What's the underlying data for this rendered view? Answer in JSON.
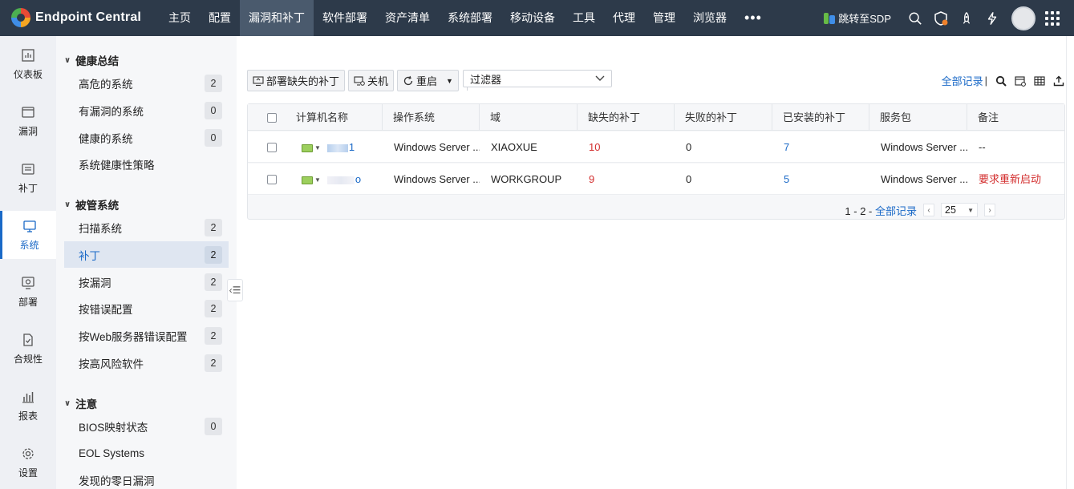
{
  "brand": {
    "name": "Endpoint Central"
  },
  "topnav": [
    "主页",
    "配置",
    "漏洞和补丁",
    "软件部署",
    "资产清单",
    "系统部署",
    "移动设备",
    "工具",
    "代理",
    "管理",
    "浏览器"
  ],
  "topnav_active": "漏洞和补丁",
  "topnav_more": "•••",
  "topright": {
    "sdp_label": "跳转至SDP"
  },
  "leftnav": [
    {
      "label": "仪表板",
      "icon": "dashboard-icon"
    },
    {
      "label": "漏洞",
      "icon": "vulnerability-icon"
    },
    {
      "label": "补丁",
      "icon": "patch-icon"
    },
    {
      "label": "系统",
      "icon": "computer-icon",
      "active": true
    },
    {
      "label": "部署",
      "icon": "deploy-icon"
    },
    {
      "label": "合规性",
      "icon": "compliance-icon"
    },
    {
      "label": "报表",
      "icon": "report-icon"
    },
    {
      "label": "设置",
      "icon": "gear-icon"
    }
  ],
  "sidepanel": {
    "health": {
      "title": "健康总结",
      "items": [
        {
          "label": "高危的系统",
          "count": "2"
        },
        {
          "label": "有漏洞的系统",
          "count": "0"
        },
        {
          "label": "健康的系统",
          "count": "0"
        },
        {
          "label": "系统健康性策略",
          "count": ""
        }
      ]
    },
    "managed": {
      "title": "被管系统",
      "items": [
        {
          "label": "扫描系统",
          "count": "2"
        },
        {
          "label": "补丁",
          "count": "2",
          "active": true
        },
        {
          "label": "按漏洞",
          "count": "2"
        },
        {
          "label": "按错误配置",
          "count": "2"
        },
        {
          "label": "按Web服务器错误配置",
          "count": "2"
        },
        {
          "label": "按高风险软件",
          "count": "2"
        }
      ]
    },
    "notice": {
      "title": "注意",
      "items": [
        {
          "label": "BIOS映射状态",
          "count": "0"
        },
        {
          "label": "EOL Systems",
          "count": ""
        },
        {
          "label": "发现的零日漏洞",
          "count": ""
        }
      ]
    }
  },
  "toolbar": {
    "deploy_label": "部署缺失的补丁",
    "shutdown_label": "关机",
    "restart_label": "重启",
    "filter_label": "过滤器",
    "all_records": "全部记录"
  },
  "table": {
    "columns": [
      "计算机名称",
      "操作系统",
      "域",
      "缺失的补丁",
      "失败的补丁",
      "已安装的补丁",
      "服务包",
      "备注"
    ],
    "rows": [
      {
        "name_suffix": "1",
        "os": "Windows Server ...",
        "domain": "XIAOXUE",
        "missing": "10",
        "failed": "0",
        "installed": "7",
        "sp": "Windows Server ...",
        "note": "--",
        "note_color": "normal"
      },
      {
        "name_suffix": "o",
        "os": "Windows Server ...",
        "domain": "WORKGROUP",
        "missing": "9",
        "failed": "0",
        "installed": "5",
        "sp": "Windows Server ...",
        "note": "要求重新启动",
        "note_color": "red"
      }
    ]
  },
  "pager": {
    "range": "1 - 2 - ",
    "all_link": "全部记录",
    "page_size": "25"
  },
  "colors": {
    "topbar": "#2d3a4a",
    "accent": "#1a69c7",
    "danger": "#d32f2f"
  }
}
